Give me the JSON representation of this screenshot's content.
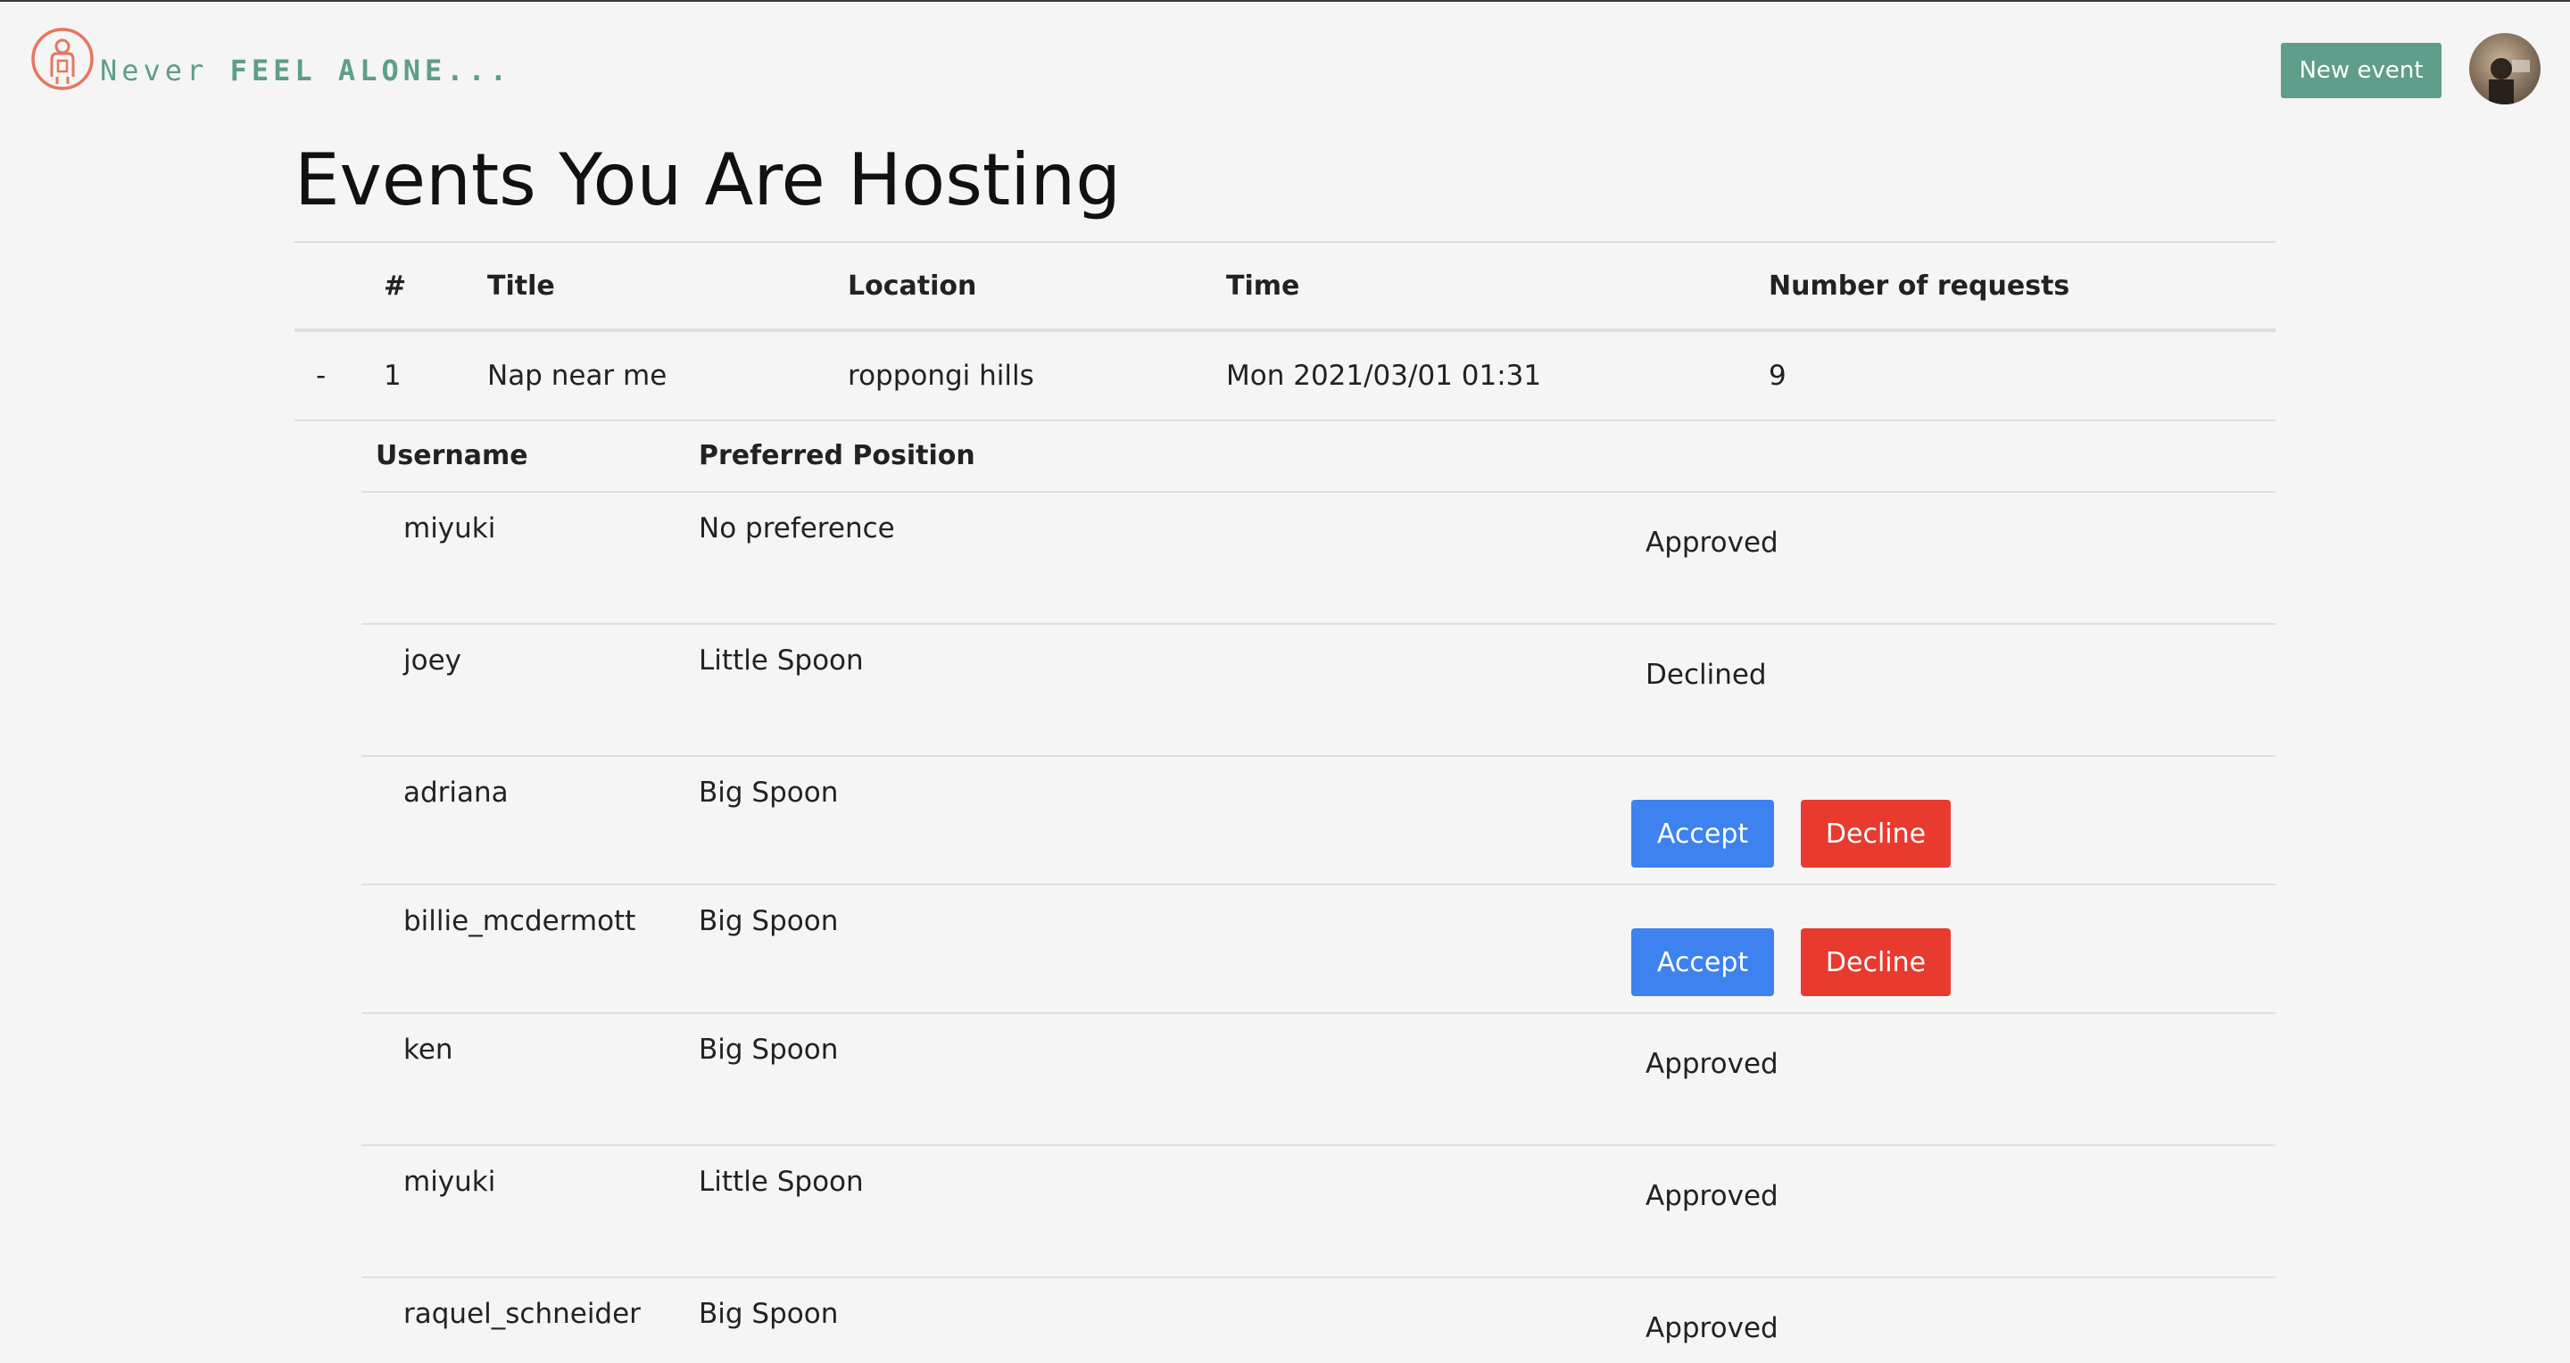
{
  "header": {
    "brand_prefix": "Never ",
    "brand_bold": "FEEL ALONE...",
    "new_event_label": "New event"
  },
  "page": {
    "title": "Events You Are Hosting"
  },
  "events_table": {
    "columns": [
      "",
      "#",
      "Title",
      "Location",
      "Time",
      "Number of requests"
    ],
    "rows": [
      {
        "toggle": "-",
        "number": "1",
        "title": "Nap near me",
        "location": "roppongi hills",
        "time": "Mon 2021/03/01 01:31",
        "requests": "9"
      }
    ]
  },
  "requests_table": {
    "columns": [
      "Username",
      "Preferred Position",
      ""
    ],
    "accept_label": "Accept",
    "decline_label": "Decline",
    "rows": [
      {
        "username": "miyuki",
        "position": "No preference",
        "status": "Approved"
      },
      {
        "username": "joey",
        "position": "Little Spoon",
        "status": "Declined"
      },
      {
        "username": "adriana",
        "position": "Big Spoon",
        "status": ""
      },
      {
        "username": "billie_mcdermott",
        "position": "Big Spoon",
        "status": ""
      },
      {
        "username": "ken",
        "position": "Big Spoon",
        "status": "Approved"
      },
      {
        "username": "miyuki",
        "position": "Little Spoon",
        "status": "Approved"
      },
      {
        "username": "raquel_schneider",
        "position": "Big Spoon",
        "status": "Approved"
      }
    ]
  },
  "colors": {
    "brand": "#5e9e8a",
    "logo": "#e8755f",
    "accept": "#3d82ee",
    "decline": "#e83a2e",
    "background": "#f5f5f5"
  }
}
